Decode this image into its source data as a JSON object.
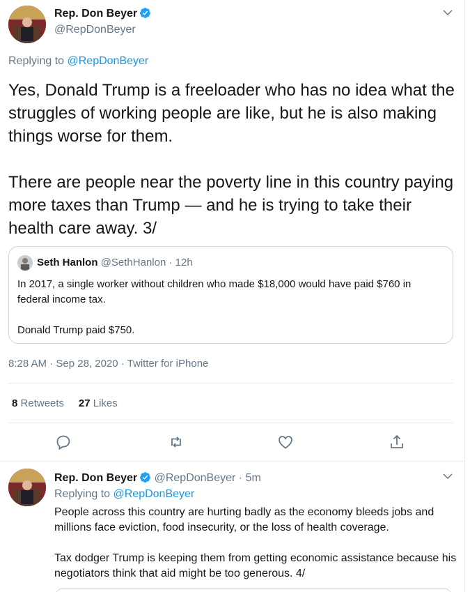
{
  "main_tweet": {
    "author_name": "Rep. Don Beyer",
    "author_handle": "@RepDonBeyer",
    "replying_prefix": "Replying to ",
    "replying_to": "@RepDonBeyer",
    "text": "Yes, Donald Trump is a freeloader who has no idea what the struggles of working people are like, but he is also making things worse for them.\n\nThere are people near the poverty line in this country paying more taxes than Trump — and he is trying to take their health care away. 3/",
    "timestamp": "8:28 AM · Sep 28, 2020 · Twitter for iPhone",
    "retweet_count": "8",
    "retweet_label": "Retweets",
    "like_count": "27",
    "like_label": "Likes",
    "actions": [
      "reply-icon",
      "retweet-icon",
      "like-icon",
      "share-icon"
    ]
  },
  "quoted_tweet": {
    "author_name": "Seth Hanlon",
    "author_handle": "@SethHanlon",
    "time": "· 12h",
    "text": "In 2017, a single worker without children who made $18,000 would have paid $760 in federal income tax.\n\nDonald Trump paid $750."
  },
  "reply_tweet": {
    "author_name": "Rep. Don Beyer",
    "author_handle": "@RepDonBeyer",
    "time": "· 5m",
    "replying_prefix": "Replying to ",
    "replying_to": "@RepDonBeyer",
    "text": "People across this country are hurting badly as the economy bleeds jobs and millions face eviction, food insecurity, or the loss of health coverage.\n\nTax dodger Trump is keeping them from getting economic assistance because his negotiators think that aid might be too generous. 4/"
  },
  "colors": {
    "link": "#1b95e0",
    "secondary_text": "#657786",
    "verified": "#1da1f2",
    "border": "#e6ecf0"
  }
}
